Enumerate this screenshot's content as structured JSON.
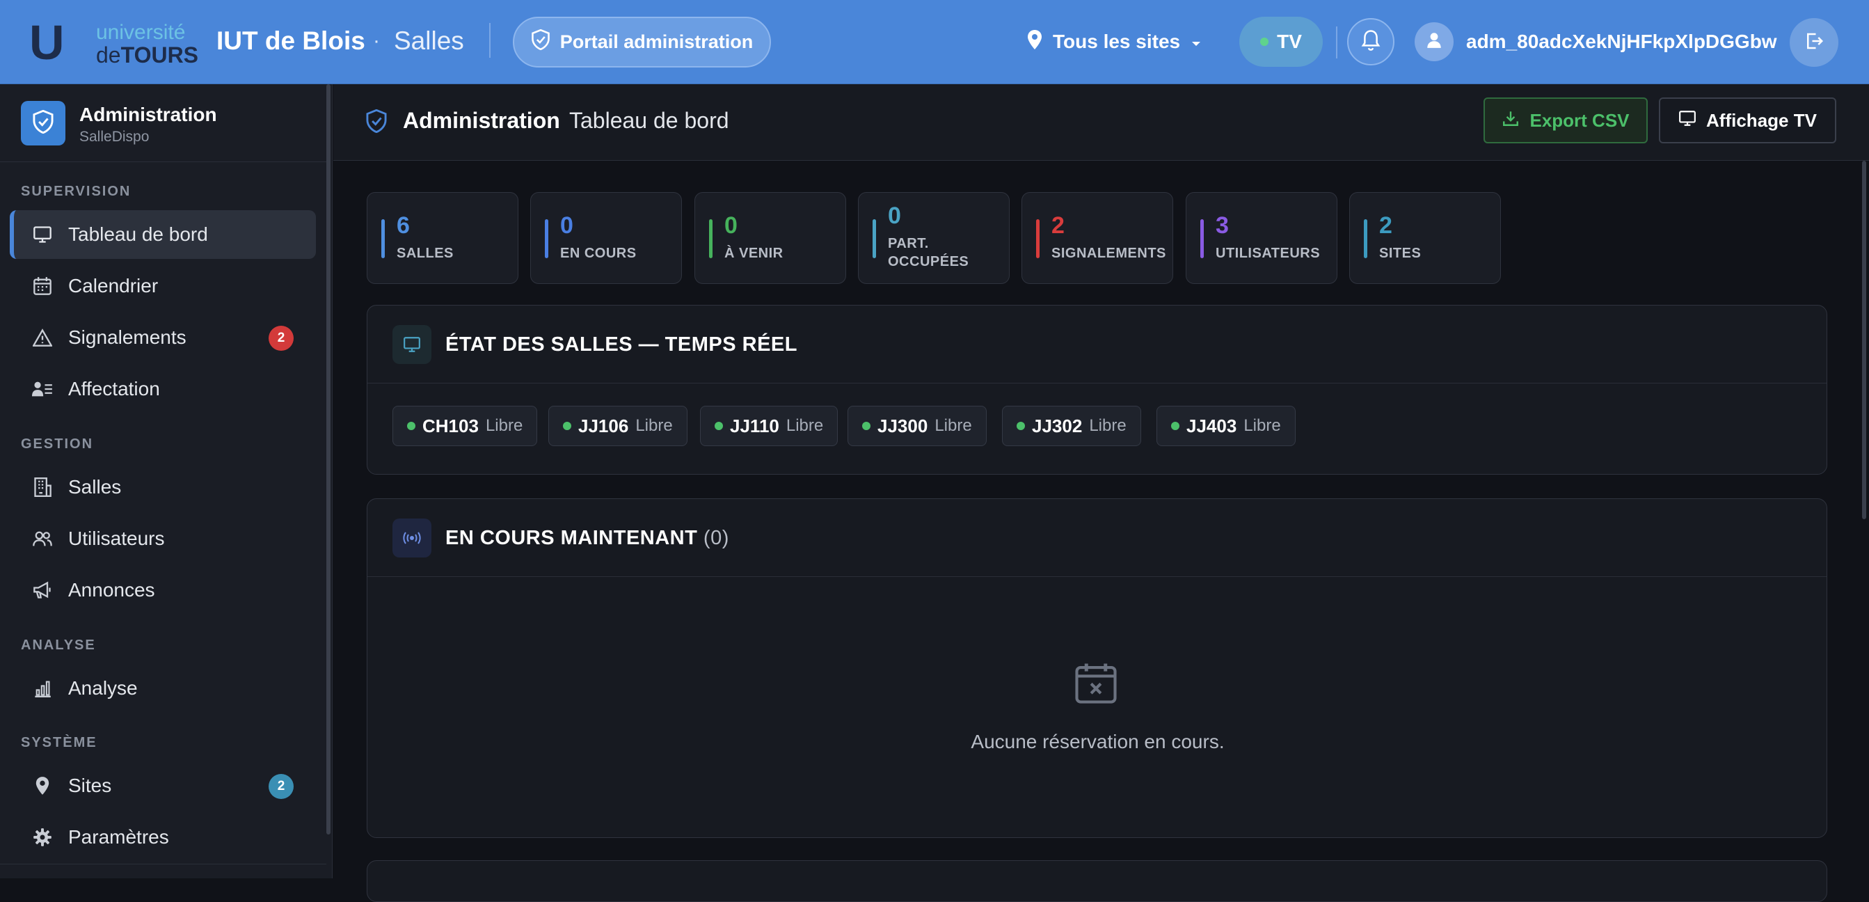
{
  "topbar": {
    "logo_u": "U",
    "logo_univ": "université",
    "logo_de": "de",
    "logo_tours": "TOURS",
    "title": "IUT de Blois",
    "separator": "·",
    "subtitle": "Salles",
    "portal_label": "Portail administration",
    "site_selector": "Tous les sites",
    "tv_label": "TV",
    "username": "adm_80adcXekNjHFkpXlpDGGbw",
    "colors": {
      "bar": "#4a86d9",
      "live": "#5fd38d"
    }
  },
  "sidebar": {
    "app_name": "Administration",
    "app_sub": "SalleDispo",
    "sections": {
      "supervision": "SUPERVISION",
      "gestion": "GESTION",
      "analyse": "ANALYSE",
      "systeme": "SYSTÈME"
    },
    "items": {
      "dashboard": "Tableau de bord",
      "calendar": "Calendrier",
      "reports": "Signalements",
      "reports_badge": "2",
      "assignment": "Affectation",
      "rooms": "Salles",
      "users": "Utilisateurs",
      "announcements": "Annonces",
      "analysis": "Analyse",
      "sites": "Sites",
      "sites_badge": "2",
      "settings": "Paramètres"
    }
  },
  "header": {
    "section": "Administration",
    "page": "Tableau de bord",
    "export_label": "Export CSV",
    "tv_display_label": "Affichage TV"
  },
  "stats": [
    {
      "value": "6",
      "label": "SALLES",
      "color": "#4f8fe0"
    },
    {
      "value": "0",
      "label": "EN COURS",
      "color": "#4a7fe3"
    },
    {
      "value": "0",
      "label": "À VENIR",
      "color": "#46b25c"
    },
    {
      "value": "0",
      "label": "PART. OCCUPÉES",
      "color": "#4aa3c4"
    },
    {
      "value": "2",
      "label": "SIGNALEMENTS",
      "color": "#d93c3c"
    },
    {
      "value": "3",
      "label": "UTILISATEURS",
      "color": "#8a5be3"
    },
    {
      "value": "2",
      "label": "SITES",
      "color": "#3c9bc0"
    }
  ],
  "rooms_card": {
    "title": "ÉTAT DES SALLES — TEMPS RÉEL",
    "rooms": [
      {
        "code": "CH103",
        "status": "Libre"
      },
      {
        "code": "JJ106",
        "status": "Libre"
      },
      {
        "code": "JJ110",
        "status": "Libre"
      },
      {
        "code": "JJ300",
        "status": "Libre"
      },
      {
        "code": "JJ302",
        "status": "Libre"
      },
      {
        "code": "JJ403",
        "status": "Libre"
      }
    ]
  },
  "current_card": {
    "title": "EN COURS MAINTENANT",
    "count": "(0)",
    "empty_text": "Aucune réservation en cours."
  }
}
